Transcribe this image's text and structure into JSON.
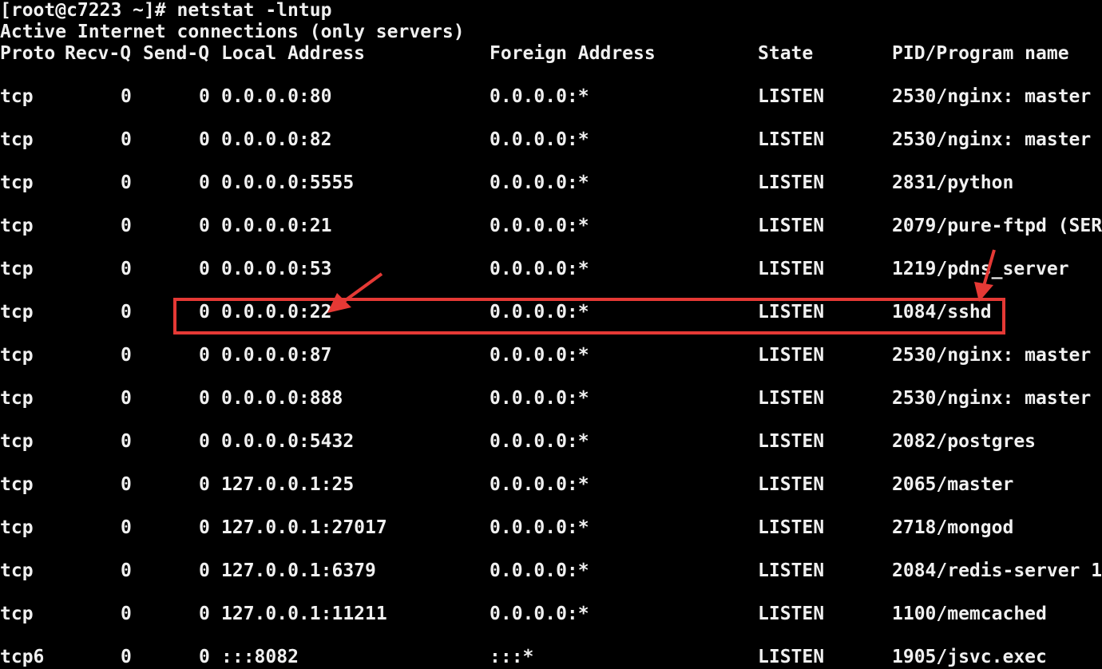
{
  "terminal": {
    "prompt_line": "[root@c7223 ~]# netstat -lntup",
    "subtitle": "Active Internet connections (only servers)",
    "headers": {
      "proto": "Proto",
      "recvq": "Recv-Q",
      "sendq": "Send-Q",
      "local": "Local Address",
      "foreign": "Foreign Address",
      "state": "State",
      "prog": "PID/Program name"
    },
    "rows": [
      {
        "proto": "tcp",
        "recvq": "0",
        "sendq": "0",
        "local": "0.0.0.0:80",
        "foreign": "0.0.0.0:*",
        "state": "LISTEN",
        "prog": "2530/nginx: master"
      },
      {
        "proto": "tcp",
        "recvq": "0",
        "sendq": "0",
        "local": "0.0.0.0:82",
        "foreign": "0.0.0.0:*",
        "state": "LISTEN",
        "prog": "2530/nginx: master"
      },
      {
        "proto": "tcp",
        "recvq": "0",
        "sendq": "0",
        "local": "0.0.0.0:5555",
        "foreign": "0.0.0.0:*",
        "state": "LISTEN",
        "prog": "2831/python"
      },
      {
        "proto": "tcp",
        "recvq": "0",
        "sendq": "0",
        "local": "0.0.0.0:21",
        "foreign": "0.0.0.0:*",
        "state": "LISTEN",
        "prog": "2079/pure-ftpd (SER"
      },
      {
        "proto": "tcp",
        "recvq": "0",
        "sendq": "0",
        "local": "0.0.0.0:53",
        "foreign": "0.0.0.0:*",
        "state": "LISTEN",
        "prog": "1219/pdns_server"
      },
      {
        "proto": "tcp",
        "recvq": "0",
        "sendq": "0",
        "local": "0.0.0.0:22",
        "foreign": "0.0.0.0:*",
        "state": "LISTEN",
        "prog": "1084/sshd"
      },
      {
        "proto": "tcp",
        "recvq": "0",
        "sendq": "0",
        "local": "0.0.0.0:87",
        "foreign": "0.0.0.0:*",
        "state": "LISTEN",
        "prog": "2530/nginx: master"
      },
      {
        "proto": "tcp",
        "recvq": "0",
        "sendq": "0",
        "local": "0.0.0.0:888",
        "foreign": "0.0.0.0:*",
        "state": "LISTEN",
        "prog": "2530/nginx: master"
      },
      {
        "proto": "tcp",
        "recvq": "0",
        "sendq": "0",
        "local": "0.0.0.0:5432",
        "foreign": "0.0.0.0:*",
        "state": "LISTEN",
        "prog": "2082/postgres"
      },
      {
        "proto": "tcp",
        "recvq": "0",
        "sendq": "0",
        "local": "127.0.0.1:25",
        "foreign": "0.0.0.0:*",
        "state": "LISTEN",
        "prog": "2065/master"
      },
      {
        "proto": "tcp",
        "recvq": "0",
        "sendq": "0",
        "local": "127.0.0.1:27017",
        "foreign": "0.0.0.0:*",
        "state": "LISTEN",
        "prog": "2718/mongod"
      },
      {
        "proto": "tcp",
        "recvq": "0",
        "sendq": "0",
        "local": "127.0.0.1:6379",
        "foreign": "0.0.0.0:*",
        "state": "LISTEN",
        "prog": "2084/redis-server 1"
      },
      {
        "proto": "tcp",
        "recvq": "0",
        "sendq": "0",
        "local": "127.0.0.1:11211",
        "foreign": "0.0.0.0:*",
        "state": "LISTEN",
        "prog": "1100/memcached"
      },
      {
        "proto": "tcp6",
        "recvq": "0",
        "sendq": "0",
        "local": ":::8082",
        "foreign": ":::*",
        "state": "LISTEN",
        "prog": "1905/jsvc.exec"
      }
    ]
  },
  "colors": {
    "background": "#000000",
    "text": "#f0f0f0",
    "annotation": "#e53935"
  }
}
